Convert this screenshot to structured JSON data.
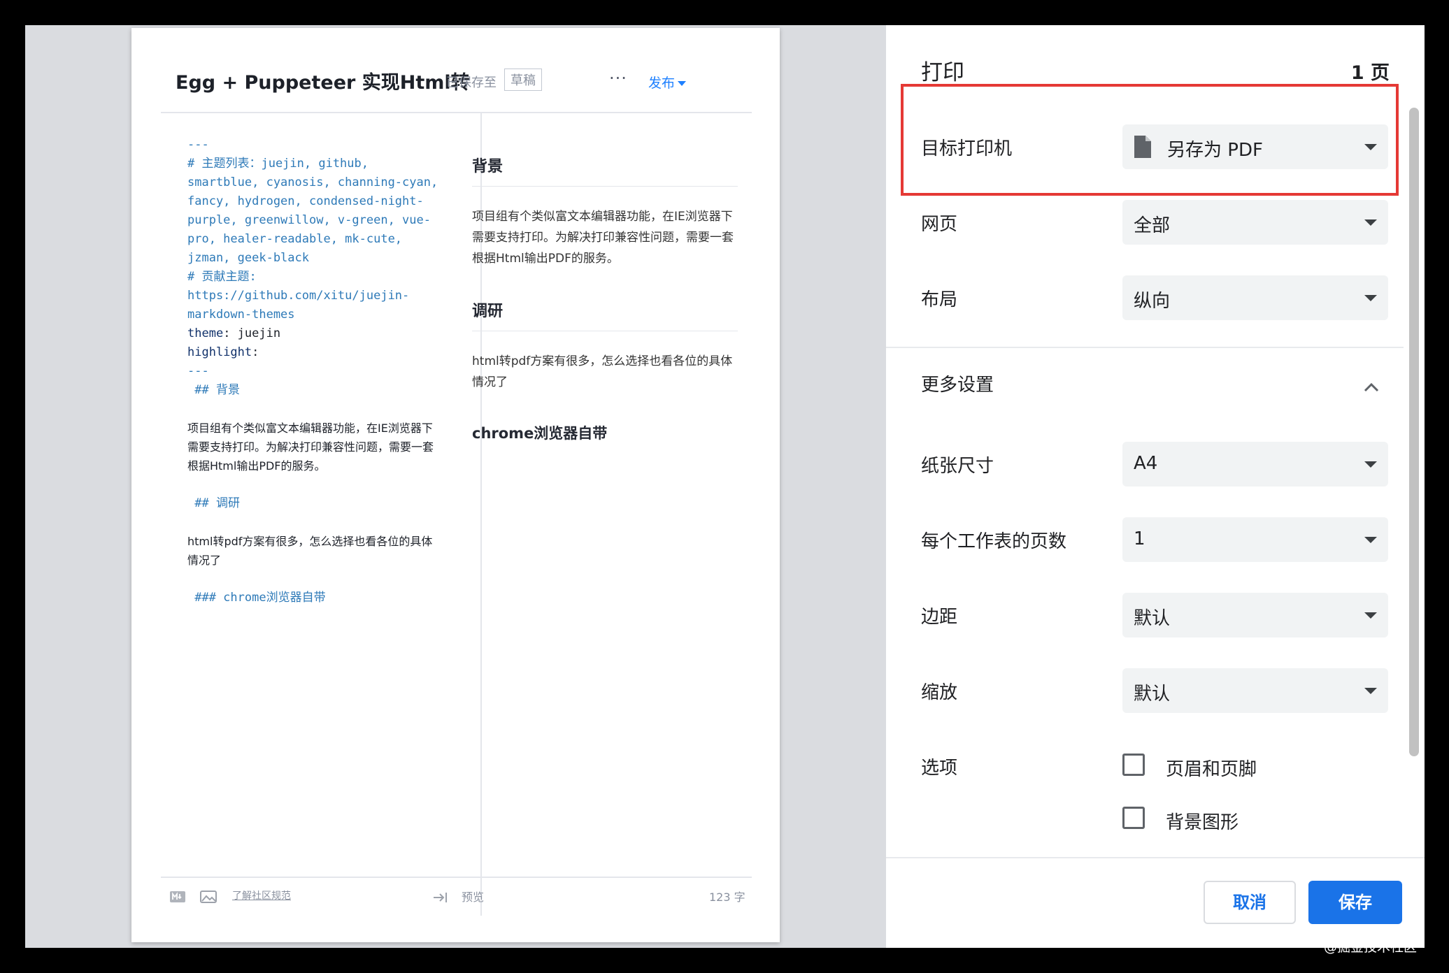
{
  "editor": {
    "title": "Egg + Puppeteer 实现Html转",
    "saved_label": "已保存至",
    "draft_label": "草稿",
    "more_label": "···",
    "publish_label": "发布"
  },
  "markdown_source": {
    "lines": [
      "---",
      "# 主题列表：juejin, github,",
      "smartblue, cyanosis, channing-cyan,",
      "fancy, hydrogen, condensed-night-",
      "purple, greenwillow, v-green, vue-",
      "pro, healer-readable, mk-cute,",
      "jzman, geek-black",
      "# 贡献主题:",
      "https://github.com/xitu/juejin-",
      "markdown-themes"
    ],
    "theme_key": "theme",
    "theme_value": " juejin",
    "highlight_key": "highlight",
    "separator_end": "---",
    "h2_background": " ## 背景",
    "para_background": " 项目组有个类似富文本编辑器功能，在IE浏览器下需要支持打印。为解决打印兼容性问题，需要一套根据Html输出PDF的服务。",
    "h2_research": " ## 调研",
    "para_research": " html转pdf方案有很多，怎么选择也看各位的具体情况了",
    "h3_chrome": " ### chrome浏览器自带"
  },
  "preview": {
    "h2_background": "背景",
    "p_background": "项目组有个类似富文本编辑器功能，在IE浏览器下需要支持打印。为解决打印兼容性问题，需要一套根据Html输出PDF的服务。",
    "h2_research": "调研",
    "p_research": "html转pdf方案有很多，怎么选择也看各位的具体情况了",
    "h3_chrome": "chrome浏览器自带"
  },
  "editor_footer": {
    "community_link": "了解社区规范",
    "preview_label": "预览",
    "word_count": "123 字"
  },
  "print_panel": {
    "title": "打印",
    "page_count": "1 页",
    "destination_label": "目标打印机",
    "destination_value": "另存为 PDF",
    "pages_label": "网页",
    "pages_value": "全部",
    "layout_label": "布局",
    "layout_value": "纵向",
    "more_settings_label": "更多设置",
    "paper_size_label": "纸张尺寸",
    "paper_size_value": "A4",
    "pages_per_sheet_label": "每个工作表的页数",
    "pages_per_sheet_value": "1",
    "margins_label": "边距",
    "margins_value": "默认",
    "scale_label": "缩放",
    "scale_value": "默认",
    "options_label": "选项",
    "option_headers_footers": "页眉和页脚",
    "option_headers_footers_checked": false,
    "option_background_graphics": "背景图形",
    "option_background_graphics_checked": false,
    "cancel_label": "取消",
    "save_label": "保存"
  },
  "colors": {
    "accent_blue": "#1a73e8",
    "highlight_red": "#e53935",
    "markdown_blue": "#2e7ab8"
  },
  "watermark": "@掘金技术社区"
}
